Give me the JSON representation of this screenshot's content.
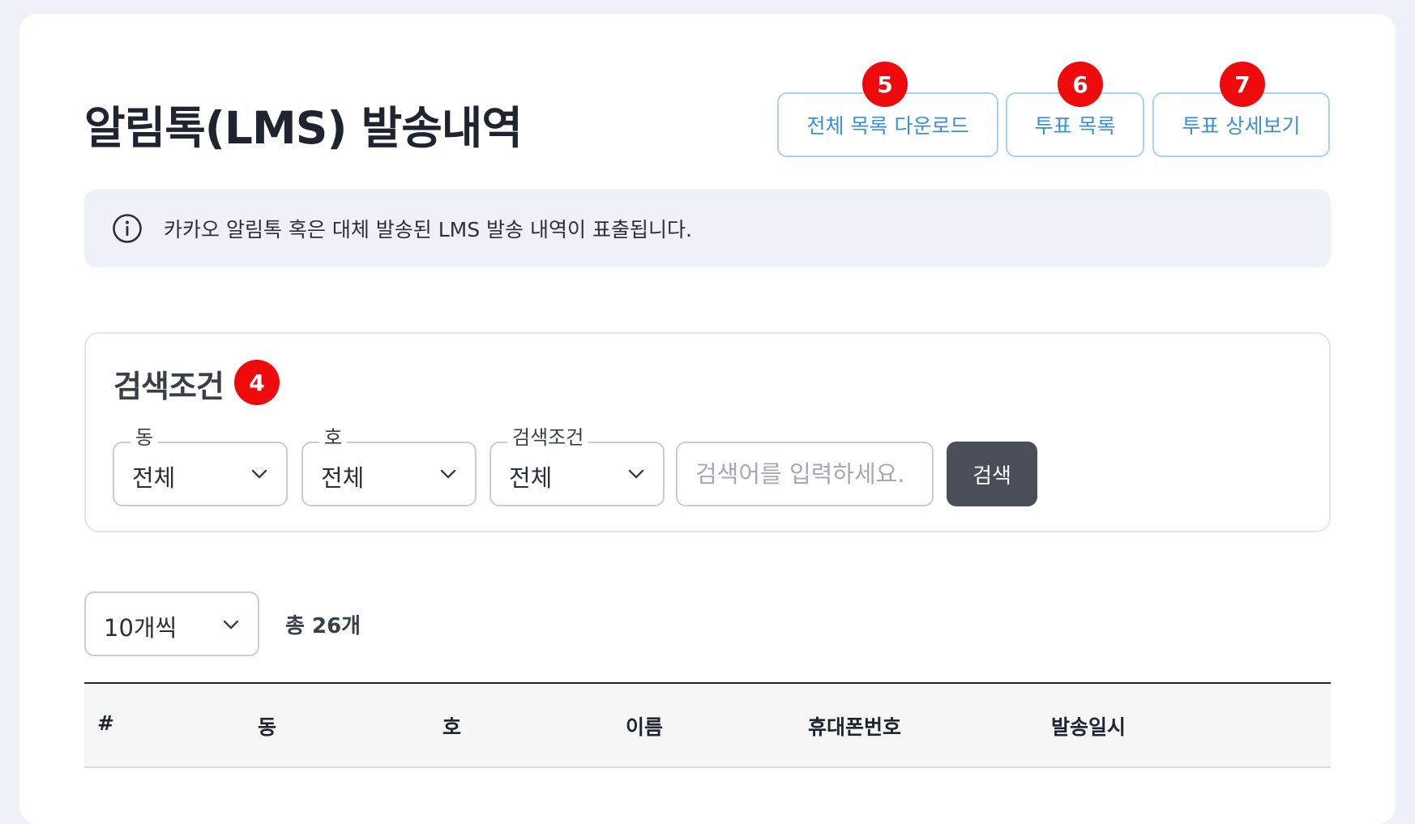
{
  "page": {
    "title": "알림톡(LMS) 발송내역"
  },
  "actions": {
    "download_all": "전체 목록 다운로드",
    "vote_list": "투표 목록",
    "vote_detail": "투표 상세보기"
  },
  "badges": {
    "download_all": "5",
    "vote_list": "6",
    "vote_detail": "7",
    "search_conditions": "4"
  },
  "notice": {
    "icon": "info-circle-icon",
    "text": "카카오 알림톡 혹은 대체 발송된 LMS 발송 내역이 표출됩니다."
  },
  "search": {
    "title": "검색조건",
    "dong": {
      "label": "동",
      "value": "전체"
    },
    "ho": {
      "label": "호",
      "value": "전체"
    },
    "condition": {
      "label": "검색조건",
      "value": "전체"
    },
    "keyword_placeholder": "검색어를 입력하세요.",
    "keyword_value": "",
    "submit_label": "검색"
  },
  "list": {
    "page_size": "10개씩",
    "total": "총 26개"
  },
  "table": {
    "columns": [
      "#",
      "동",
      "호",
      "이름",
      "휴대폰번호",
      "발송일시"
    ]
  },
  "colors": {
    "accent_button_border": "#a9d0f5",
    "accent_button_text": "#3b8fd6",
    "badge": "#ee0a0a",
    "primary_dark_button": "#4a4e58",
    "page_background": "#eef1f7"
  }
}
